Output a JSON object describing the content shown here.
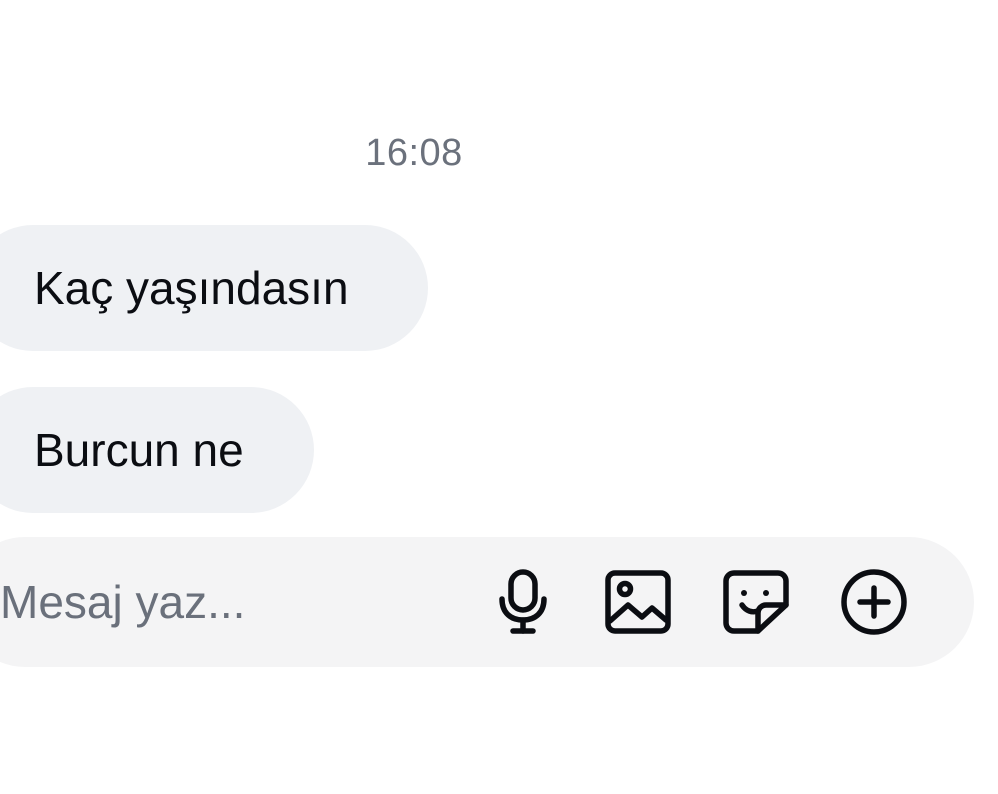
{
  "thread": {
    "timestamp": "16:08",
    "messages": [
      {
        "text": "Kaç yaşındasın",
        "sender": "other"
      },
      {
        "text": "Burcun ne",
        "sender": "other"
      }
    ]
  },
  "composer": {
    "placeholder": "Mesaj yaz...",
    "value": "",
    "icons": [
      "microphone-icon",
      "image-icon",
      "sticker-icon",
      "plus-circle-icon"
    ]
  },
  "colors": {
    "bubble_background": "#eff1f4",
    "composer_background": "#f4f4f5",
    "timestamp_text": "#6b717c",
    "icon_stroke": "#0b0d12"
  }
}
